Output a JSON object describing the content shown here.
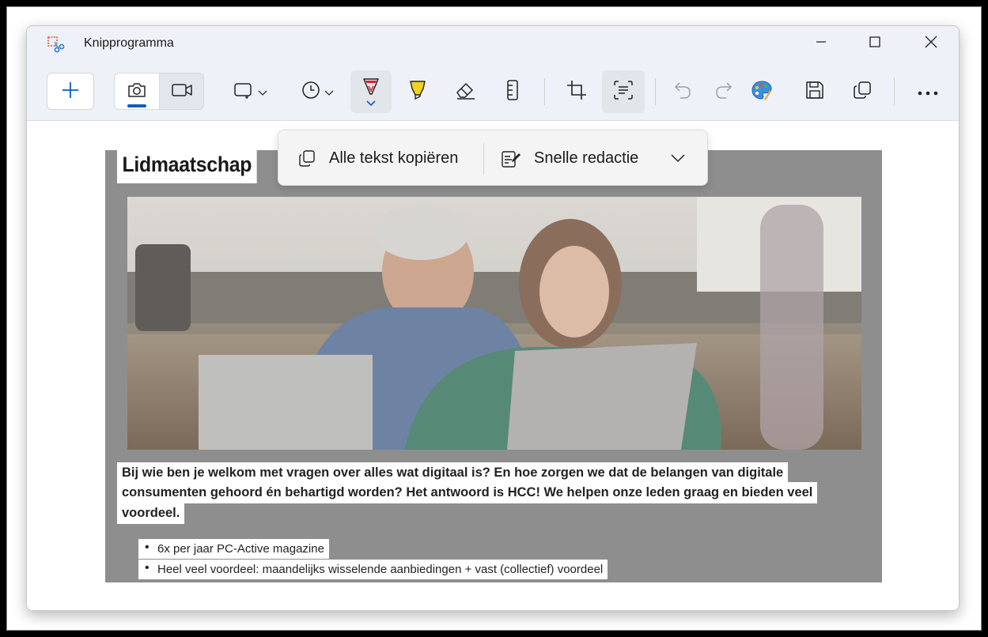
{
  "app": {
    "title": "Knipprogramma"
  },
  "icons": {
    "app": "snipping-tool-icon",
    "minimize": "minimize-icon",
    "maximize": "maximize-icon",
    "close": "close-icon",
    "new": "plus-icon",
    "photo": "camera-icon",
    "video": "video-icon",
    "shape": "rectangle-snip-icon",
    "delay": "clock-icon",
    "pen": "pen-icon",
    "highlighter": "highlighter-icon",
    "eraser": "eraser-icon",
    "ruler": "ruler-icon",
    "crop": "crop-icon",
    "text_actions": "text-actions-icon",
    "undo": "undo-icon",
    "redo": "redo-icon",
    "paint": "paint-icon",
    "save": "save-icon",
    "copy": "copy-icon",
    "more": "more-icon"
  },
  "colors": {
    "accent": "#0f5cbf",
    "pen": "#d8232a",
    "highlighter": "#f2d21b"
  },
  "popup": {
    "copy_all_text": "Alle tekst kopiëren",
    "quick_redact": "Snelle redactie"
  },
  "snip": {
    "heading": "Lidmaatschap",
    "paragraph_lines": [
      "Bij wie ben je welkom met vragen over alles wat digitaal is? En hoe zorgen we dat de belangen van digitale",
      "consumenten gehoord én behartigd worden? Het antwoord is HCC! We helpen onze leden graag en bieden veel",
      "voordeel."
    ],
    "bullets": [
      "6x per jaar PC-Active magazine",
      "Heel veel voordeel: maandelijks wisselende aanbiedingen + vast (collectief) voordeel"
    ]
  }
}
